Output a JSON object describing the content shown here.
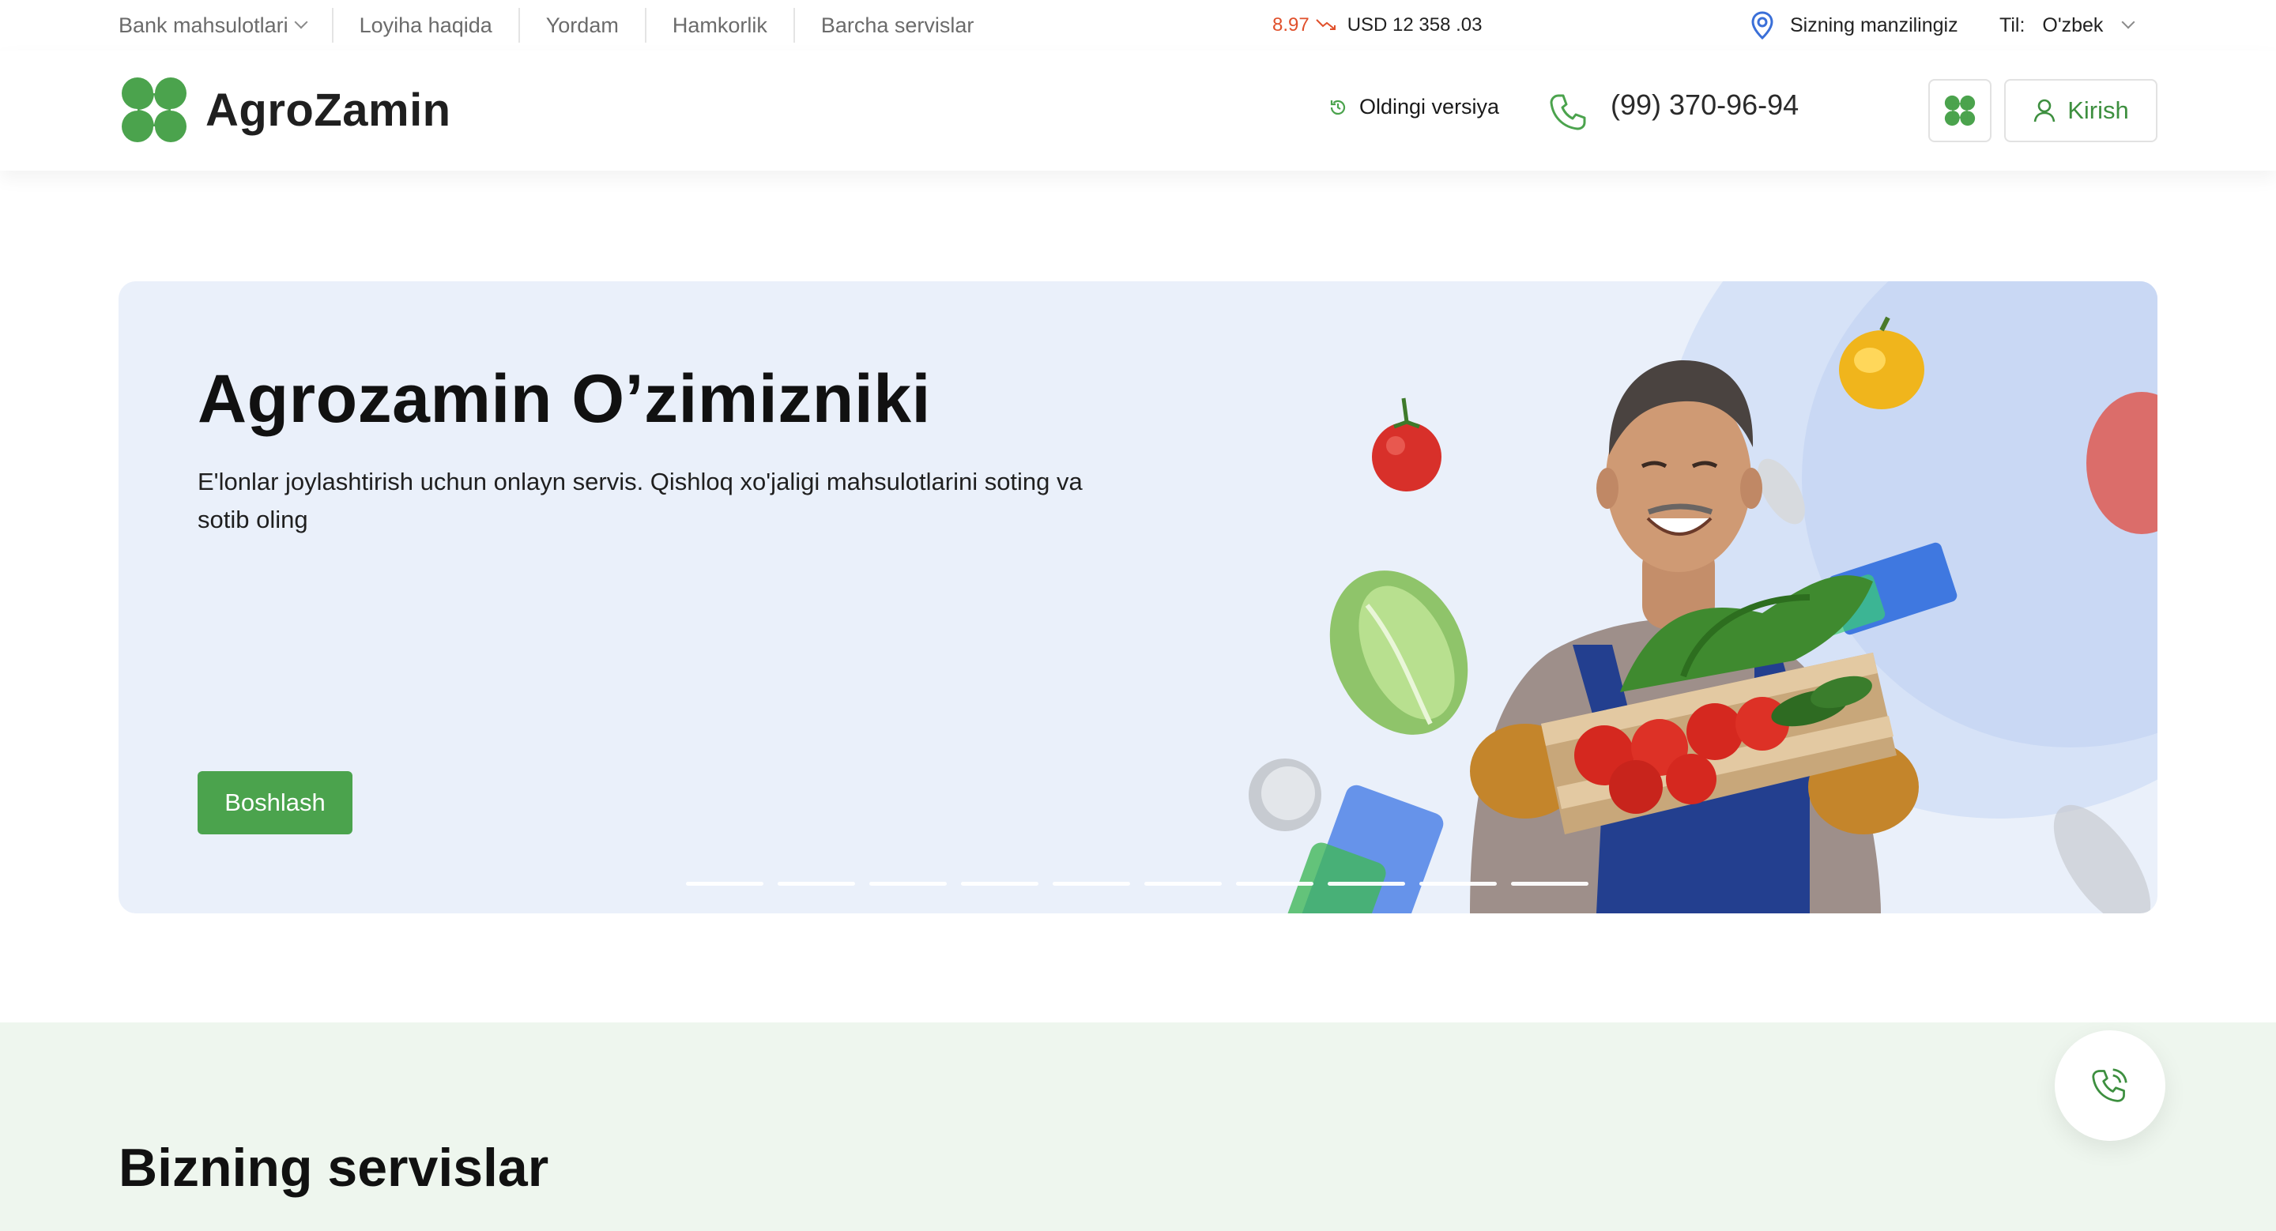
{
  "top_nav": {
    "items": [
      {
        "label": "Bank mahsulotlari",
        "has_dropdown": true
      },
      {
        "label": "Loyiha haqida"
      },
      {
        "label": "Yordam"
      },
      {
        "label": "Hamkorlik"
      },
      {
        "label": "Barcha servislar"
      }
    ]
  },
  "currency": {
    "change": "8.97",
    "trend": "down",
    "value": "USD 12 358 .03"
  },
  "location": {
    "label": "Sizning manzilingiz",
    "icon": "map-pin-icon"
  },
  "language": {
    "label": "Til:",
    "selected": "O'zbek"
  },
  "header": {
    "logo_text": "AgroZamin",
    "prev_version_label": "Oldingi versiya",
    "phone": "(99) 370-96-94",
    "login_label": "Kirish"
  },
  "hero": {
    "title": "Agrozamin O’zimizniki",
    "description": "E'lonlar joylashtirish uchun onlayn servis. Qishloq xo'jaligi mahsulotlarini soting va sotib oling",
    "cta_label": "Boshlash",
    "slides_total": 10,
    "active_slide": 1
  },
  "services": {
    "title": "Bizning servislar"
  },
  "colors": {
    "brand_green": "#4ba34d",
    "brand_green_dark": "#3d8f3f",
    "hero_bg": "#eaf0fa",
    "services_bg": "#eef6ee",
    "rate_down": "#e0502b"
  }
}
